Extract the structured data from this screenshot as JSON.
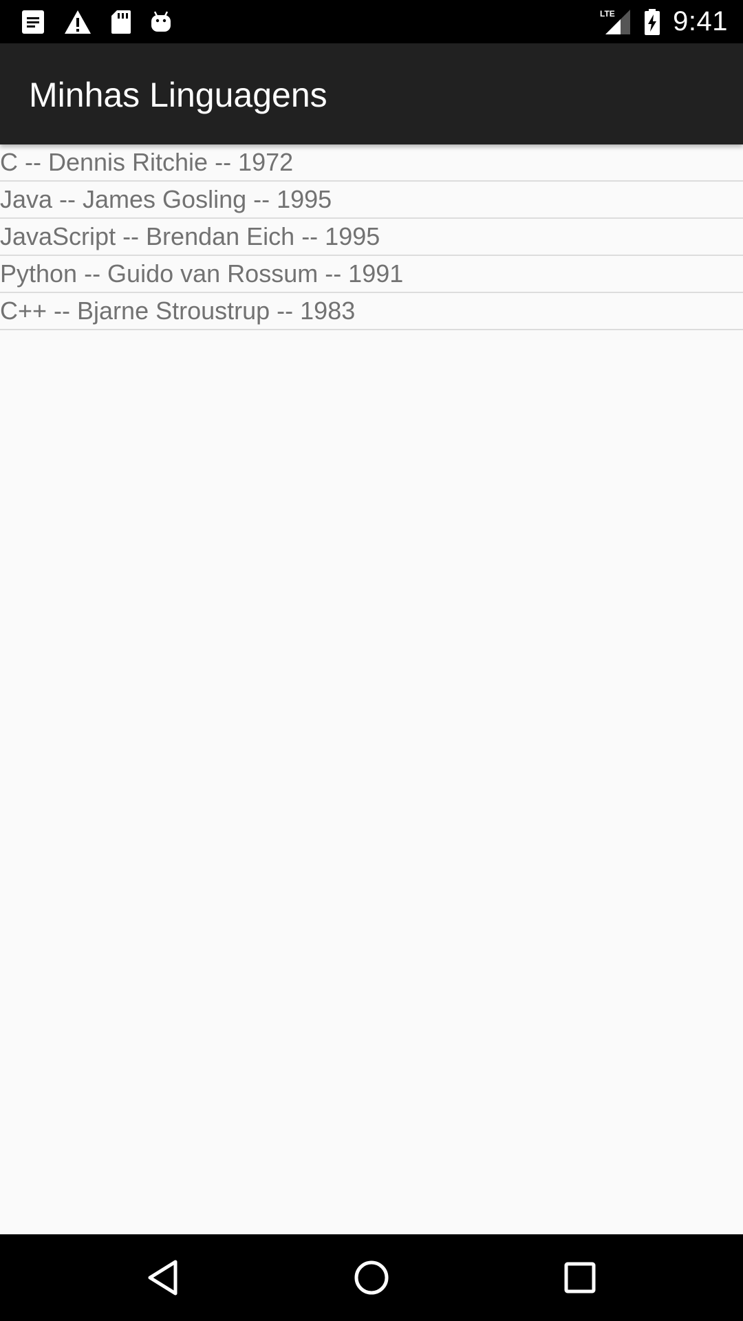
{
  "status_bar": {
    "time": "9:41",
    "network_label": "LTE",
    "left_icons": [
      "notes-icon",
      "warning-icon",
      "sd-card-icon",
      "android-icon"
    ],
    "right_icons": [
      "lte-signal-icon",
      "battery-charging-icon"
    ]
  },
  "app_bar": {
    "title": "Minhas Linguagens",
    "background": "#212121"
  },
  "languages": [
    {
      "label": "C -- Dennis Ritchie -- 1972"
    },
    {
      "label": "Java -- James Gosling -- 1995"
    },
    {
      "label": "JavaScript -- Brendan Eich -- 1995"
    },
    {
      "label": "Python -- Guido van Rossum -- 1991"
    },
    {
      "label": "C++ -- Bjarne Stroustrup -- 1983"
    }
  ],
  "nav_bar": {
    "buttons": [
      "back-icon",
      "home-icon",
      "recents-icon"
    ]
  }
}
